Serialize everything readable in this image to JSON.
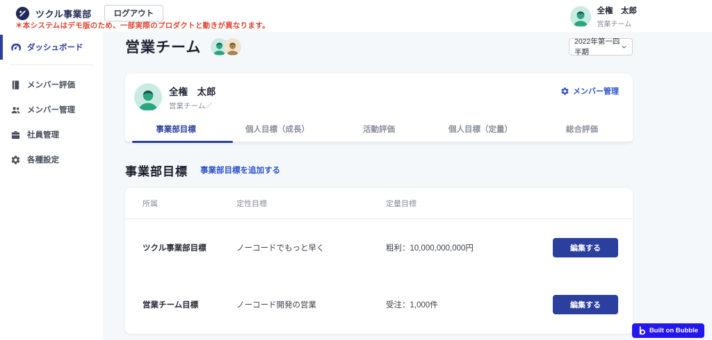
{
  "header": {
    "brand": "ツクル事業部",
    "logout_label": "ログアウト",
    "warning": "＊本システムはデモ版のため、一部実際のプロダクトと動きが異なります。",
    "user": {
      "name": "全権　太郎",
      "team": "営業チーム"
    }
  },
  "sidebar": {
    "items": [
      {
        "label": "ダッシュボード",
        "icon": "dashboard-icon",
        "active": true
      },
      {
        "label": "メンバー評価",
        "icon": "book-icon",
        "active": false
      },
      {
        "label": "メンバー管理",
        "icon": "users-icon",
        "active": false
      },
      {
        "label": "社員管理",
        "icon": "briefcase-icon",
        "active": false
      },
      {
        "label": "各種設定",
        "icon": "gear-icon",
        "active": false
      }
    ]
  },
  "main": {
    "page_title": "営業チーム",
    "team_avatar_icons": [
      "person-icon-green",
      "person-icon-brown"
    ],
    "period_select": {
      "value": "2022年第一四半期",
      "icon": "chevron-down-icon"
    },
    "profile_card": {
      "name": "全権　太郎",
      "team": "営業チーム／",
      "manage_link": "メンバー管理",
      "manage_icon": "gear-icon",
      "tabs": [
        {
          "label": "事業部目標",
          "active": true
        },
        {
          "label": "個人目標（成長）",
          "active": false
        },
        {
          "label": "活動評価",
          "active": false
        },
        {
          "label": "個人目標（定量）",
          "active": false
        },
        {
          "label": "総合評価",
          "active": false
        }
      ]
    },
    "goals_section": {
      "title": "事業部目標",
      "add_link": "事業部目標を追加する",
      "table": {
        "headers": [
          "所属",
          "定性目標",
          "定量目標"
        ],
        "rows": [
          {
            "affiliation": "ツクル事業部目標",
            "qualitative": "ノーコードでもっと早く",
            "quantitative": "粗利：10,000,000,000円",
            "action": "編集する"
          },
          {
            "affiliation": "営業チーム目標",
            "qualitative": "ノーコード開発の営業",
            "quantitative": "受注：1,000件",
            "action": "編集する"
          }
        ]
      }
    }
  },
  "badge": {
    "text": "Built on Bubble",
    "icon": "bubble-logo-icon"
  },
  "colors": {
    "primary_blue": "#2b3f9e",
    "link_blue": "#2a52cc",
    "warning_red": "#e0432f",
    "brand_navy": "#232c55",
    "background": "#f5f8fb",
    "avatar_teal_bg": "#c9ebe3",
    "avatar_tan_bg": "#f1e4cf",
    "avatar_green_person": "#2ba57f",
    "avatar_brown_person": "#a5854f",
    "bubble_badge_blue": "#2417ee"
  }
}
